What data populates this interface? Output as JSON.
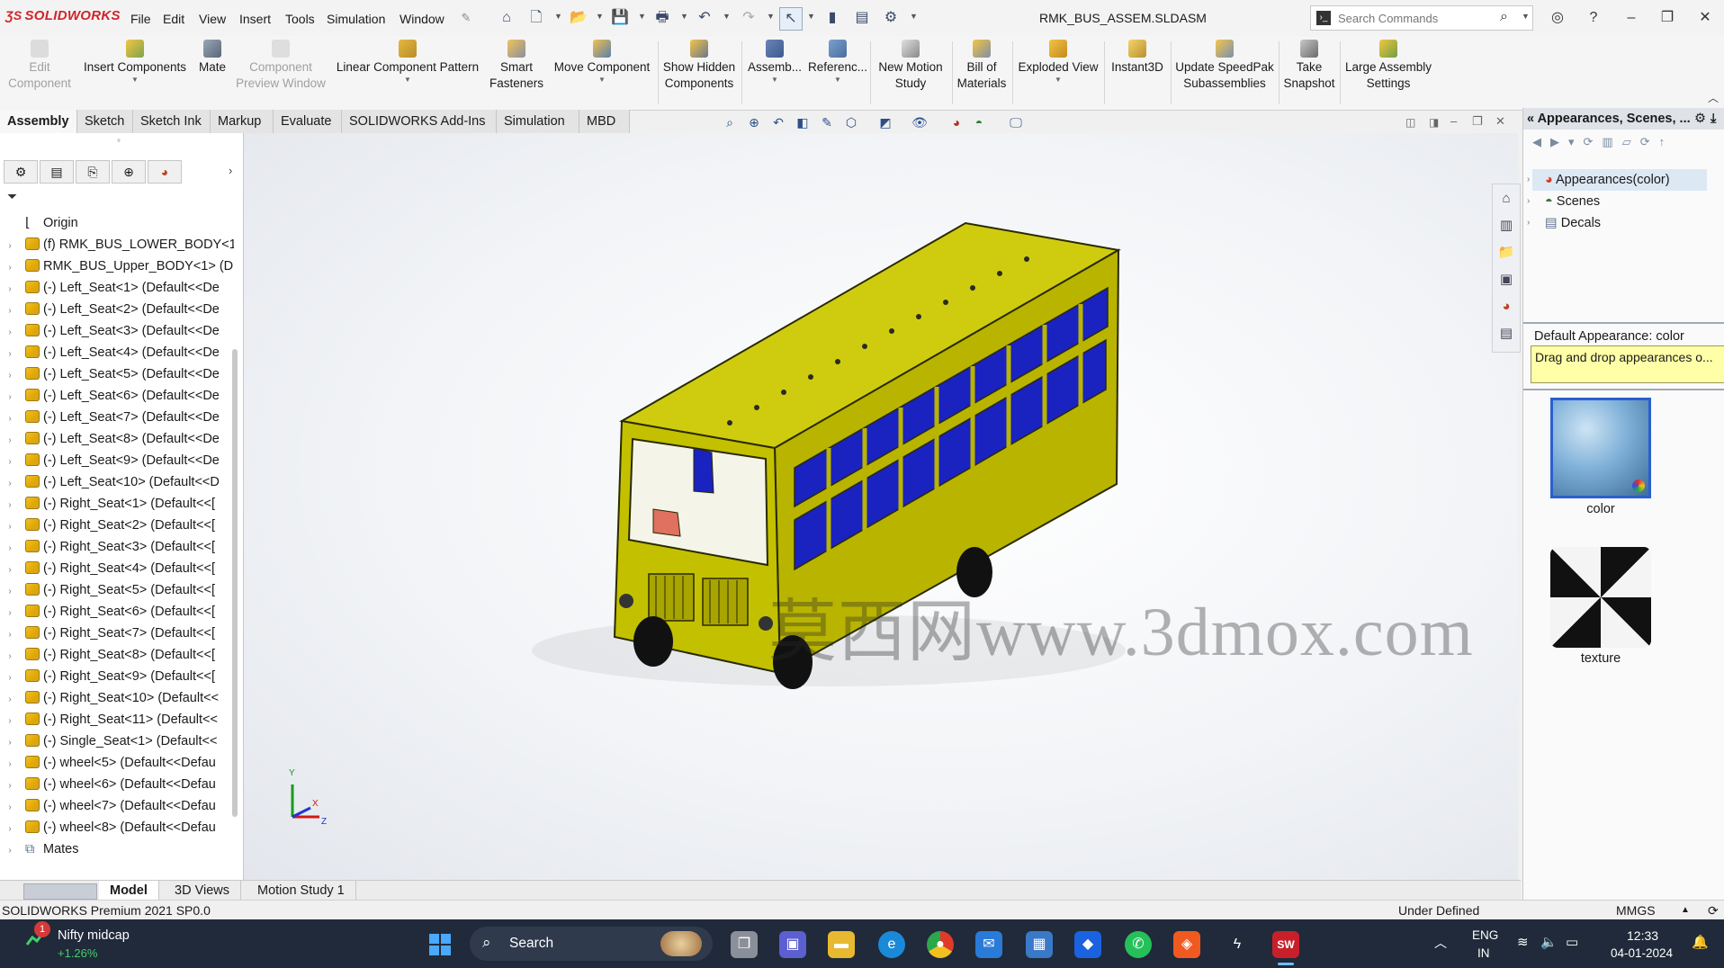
{
  "app": {
    "logo": "SOLIDWORKS",
    "document_title": "RMK_BUS_ASSEM.SLDASM",
    "menus": [
      "File",
      "Edit",
      "View",
      "Insert",
      "Tools",
      "Simulation",
      "Window"
    ],
    "search_placeholder": "Search Commands"
  },
  "ribbon": {
    "buttons": [
      {
        "label": "Edit Component",
        "line1": "Edit",
        "line2": "Component",
        "disabled": true
      },
      {
        "label": "Insert Components",
        "line1": "Insert Components",
        "line2": ""
      },
      {
        "label": "Mate",
        "line1": "Mate",
        "line2": ""
      },
      {
        "label": "Component Preview Window",
        "line1": "Component",
        "line2": "Preview Window",
        "disabled": true
      },
      {
        "label": "Linear Component Pattern",
        "line1": "Linear Component Pattern",
        "line2": ""
      },
      {
        "label": "Smart Fasteners",
        "line1": "Smart",
        "line2": "Fasteners"
      },
      {
        "label": "Move Component",
        "line1": "Move Component",
        "line2": ""
      },
      {
        "label": "Show Hidden Components",
        "line1": "Show Hidden",
        "line2": "Components"
      },
      {
        "label": "Assemb...",
        "line1": "Assemb...",
        "line2": ""
      },
      {
        "label": "Referenc...",
        "line1": "Referenc...",
        "line2": ""
      },
      {
        "label": "New Motion Study",
        "line1": "New Motion",
        "line2": "Study"
      },
      {
        "label": "Bill of Materials",
        "line1": "Bill of",
        "line2": "Materials"
      },
      {
        "label": "Exploded View",
        "line1": "Exploded View",
        "line2": ""
      },
      {
        "label": "Instant3D",
        "line1": "Instant3D",
        "line2": ""
      },
      {
        "label": "Update SpeedPak Subassemblies",
        "line1": "Update SpeedPak",
        "line2": "Subassemblies"
      },
      {
        "label": "Take Snapshot",
        "line1": "Take",
        "line2": "Snapshot"
      },
      {
        "label": "Large Assembly Settings",
        "line1": "Large Assembly",
        "line2": "Settings"
      }
    ]
  },
  "tabs": [
    "Assembly",
    "Sketch",
    "Sketch Ink",
    "Markup",
    "Evaluate",
    "SOLIDWORKS Add-Ins",
    "Simulation",
    "MBD"
  ],
  "tree": {
    "origin": "Origin",
    "items": [
      "(f) RMK_BUS_LOWER_BODY<1",
      "RMK_BUS_Upper_BODY<1> (D",
      "(-) Left_Seat<1> (Default<<De",
      "(-) Left_Seat<2> (Default<<De",
      "(-) Left_Seat<3> (Default<<De",
      "(-) Left_Seat<4> (Default<<De",
      "(-) Left_Seat<5> (Default<<De",
      "(-) Left_Seat<6> (Default<<De",
      "(-) Left_Seat<7> (Default<<De",
      "(-) Left_Seat<8> (Default<<De",
      "(-) Left_Seat<9> (Default<<De",
      "(-) Left_Seat<10> (Default<<D",
      "(-) Right_Seat<1> (Default<<[",
      "(-) Right_Seat<2> (Default<<[",
      "(-) Right_Seat<3> (Default<<[",
      "(-) Right_Seat<4> (Default<<[",
      "(-) Right_Seat<5> (Default<<[",
      "(-) Right_Seat<6> (Default<<[",
      "(-) Right_Seat<7> (Default<<[",
      "(-) Right_Seat<8> (Default<<[",
      "(-) Right_Seat<9> (Default<<[",
      "(-) Right_Seat<10> (Default<<",
      "(-) Right_Seat<11> (Default<<",
      "(-) Single_Seat<1> (Default<<",
      "(-) wheel<5> (Default<<Defau",
      "(-) wheel<6> (Default<<Defau",
      "(-) wheel<7> (Default<<Defau",
      "(-) wheel<8> (Default<<Defau"
    ],
    "mates": "Mates"
  },
  "graphics": {
    "watermark": "莫西网www.3dmox.com",
    "triad_y": "Y",
    "triad_x": "X",
    "triad_z": "Z",
    "body_color": "#c8c400",
    "window_color": "#1a22c0"
  },
  "taskpane": {
    "title": "Appearances, Scenes, ...",
    "tree": [
      "Appearances(color)",
      "Scenes",
      "Decals"
    ],
    "default_appearance": "Default Appearance: color",
    "tip": "Drag and drop appearances o...",
    "thumbs": [
      "color",
      "texture"
    ]
  },
  "bottom_tabs": [
    "Model",
    "3D Views",
    "Motion Study 1"
  ],
  "status": {
    "left": "SOLIDWORKS Premium 2021 SP0.0",
    "state": "Under Defined",
    "units": "MMGS"
  },
  "taskbar": {
    "ticker_name": "Nifty midcap",
    "ticker_change": "+1.26%",
    "badge": "1",
    "search": "Search",
    "lang1": "ENG",
    "lang2": "IN",
    "time": "12:33",
    "date": "04-01-2024"
  }
}
